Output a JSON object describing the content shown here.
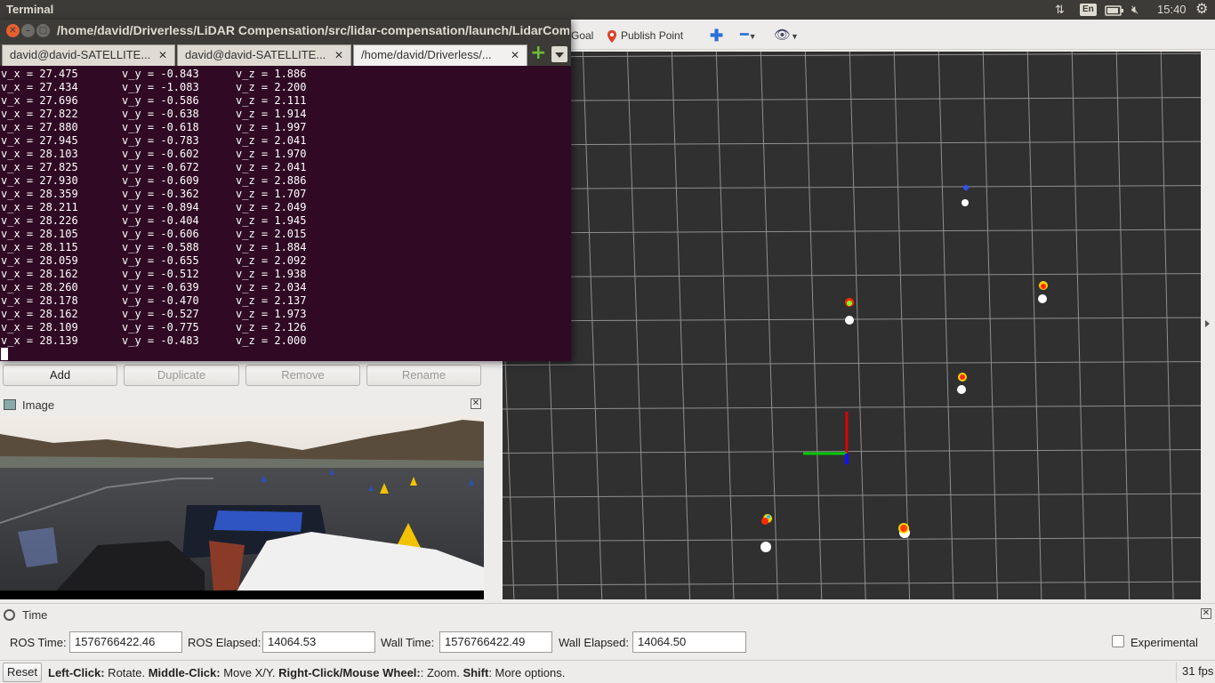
{
  "topbar": {
    "app_name": "Terminal",
    "lang": "En",
    "clock": "15:40"
  },
  "rviz": {
    "toolbar": {
      "goal_label": "Goal",
      "publish_point_label": "Publish Point"
    },
    "displays_buttons": {
      "add": "Add",
      "duplicate": "Duplicate",
      "remove": "Remove",
      "rename": "Rename"
    },
    "image_panel": {
      "title": "Image"
    },
    "time_panel": {
      "title": "Time",
      "ros_time_label": "ROS Time:",
      "ros_time_value": "1576766422.46",
      "ros_elapsed_label": "ROS Elapsed:",
      "ros_elapsed_value": "14064.53",
      "wall_time_label": "Wall Time:",
      "wall_time_value": "1576766422.49",
      "wall_elapsed_label": "Wall Elapsed:",
      "wall_elapsed_value": "14064.50",
      "experimental_label": "Experimental"
    },
    "statusbar": {
      "reset": "Reset",
      "hint_b1": "Left-Click:",
      "hint_t1": " Rotate. ",
      "hint_b2": "Middle-Click:",
      "hint_t2": " Move X/Y. ",
      "hint_b3": "Right-Click/Mouse Wheel:",
      "hint_t3": ": Zoom. ",
      "hint_b4": "Shift",
      "hint_t4": ": More options.",
      "fps": "31 fps"
    }
  },
  "terminal": {
    "title": "/home/david/Driverless/LiDAR Compensation/src/lidar-compensation/launch/LidarCompensation.launch",
    "tabs": [
      {
        "label": "david@david-SATELLITE..."
      },
      {
        "label": "david@david-SATELLITE..."
      },
      {
        "label": "/home/david/Driverless/..."
      }
    ],
    "lines": [
      [
        "v_x = 27.475",
        "v_y = -0.843",
        "v_z = 1.886"
      ],
      [
        "v_x = 27.434",
        "v_y = -1.083",
        "v_z = 2.200"
      ],
      [
        "v_x = 27.696",
        "v_y = -0.586",
        "v_z = 2.111"
      ],
      [
        "v_x = 27.822",
        "v_y = -0.638",
        "v_z = 1.914"
      ],
      [
        "v_x = 27.880",
        "v_y = -0.618",
        "v_z = 1.997"
      ],
      [
        "v_x = 27.945",
        "v_y = -0.783",
        "v_z = 2.041"
      ],
      [
        "v_x = 28.103",
        "v_y = -0.602",
        "v_z = 1.970"
      ],
      [
        "v_x = 27.825",
        "v_y = -0.672",
        "v_z = 2.041"
      ],
      [
        "v_x = 27.930",
        "v_y = -0.609",
        "v_z = 2.886"
      ],
      [
        "v_x = 28.359",
        "v_y = -0.362",
        "v_z = 1.707"
      ],
      [
        "v_x = 28.211",
        "v_y = -0.894",
        "v_z = 2.049"
      ],
      [
        "v_x = 28.226",
        "v_y = -0.404",
        "v_z = 1.945"
      ],
      [
        "v_x = 28.105",
        "v_y = -0.606",
        "v_z = 2.015"
      ],
      [
        "v_x = 28.115",
        "v_y = -0.588",
        "v_z = 1.884"
      ],
      [
        "v_x = 28.059",
        "v_y = -0.655",
        "v_z = 2.092"
      ],
      [
        "v_x = 28.162",
        "v_y = -0.512",
        "v_z = 1.938"
      ],
      [
        "v_x = 28.260",
        "v_y = -0.639",
        "v_z = 2.034"
      ],
      [
        "v_x = 28.178",
        "v_y = -0.470",
        "v_z = 2.137"
      ],
      [
        "v_x = 28.162",
        "v_y = -0.527",
        "v_z = 1.973"
      ],
      [
        "v_x = 28.109",
        "v_y = -0.775",
        "v_z = 2.126"
      ],
      [
        "v_x = 28.139",
        "v_y = -0.483",
        "v_z = 2.000"
      ]
    ]
  },
  "colors": {
    "terminal_bg": "#300a24",
    "panel_bg": "#3c3b37",
    "rviz_bg": "#edeceb",
    "view_bg": "#303030",
    "axis_x": "#e00000",
    "axis_y": "#00c800",
    "cone_detected": "#ffffff",
    "cone_red": "#ff2a00",
    "cone_yellow": "#ffd400",
    "cone_blue": "#3050ff"
  },
  "icons": {
    "network": "transfer-arrows-icon",
    "battery": "battery-icon",
    "volume": "muted-speaker-icon",
    "settings": "gear-icon",
    "publish_point": "map-pin-icon",
    "add_tool": "plus-icon",
    "remove_tool": "minus-icon",
    "camera": "eye-icon"
  }
}
